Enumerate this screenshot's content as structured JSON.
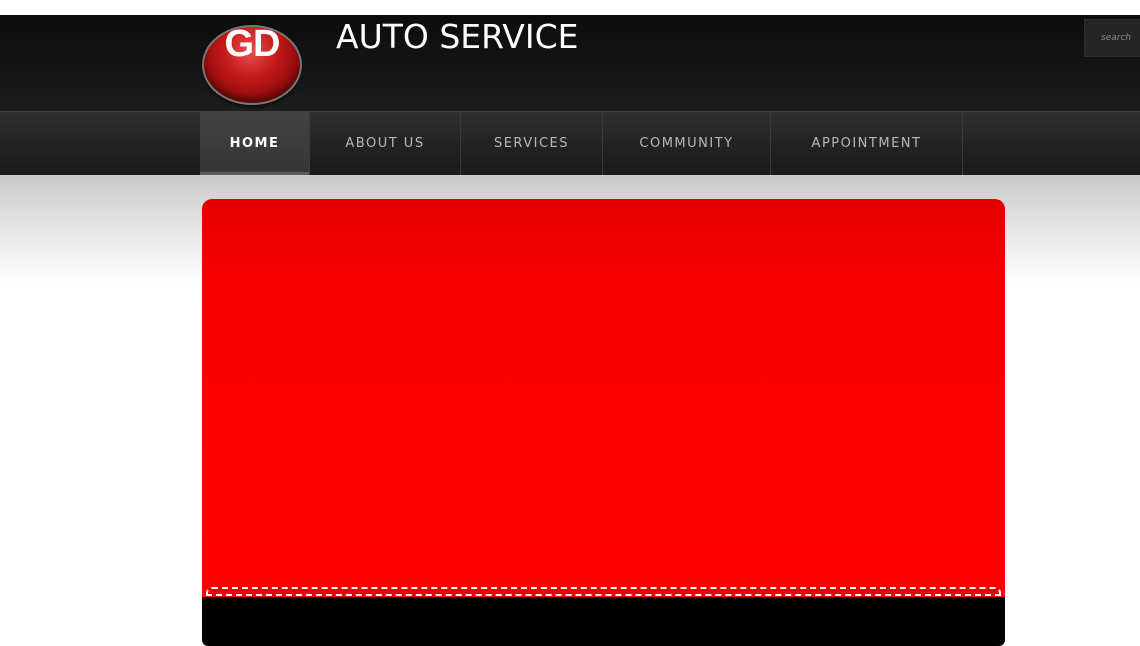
{
  "header": {
    "logo_text": "GD",
    "brand_title": "AUTO SERVICE",
    "search_placeholder": "search"
  },
  "nav": {
    "items": [
      {
        "label": "HOME",
        "active": true
      },
      {
        "label": "ABOUT US",
        "active": false
      },
      {
        "label": "SERVICES",
        "active": false
      },
      {
        "label": "COMMUNITY",
        "active": false
      },
      {
        "label": "APPOINTMENT",
        "active": false
      }
    ]
  },
  "colors": {
    "header_bg": "#111111",
    "nav_bg": "#262626",
    "logo_red": "#c41818",
    "hero_red": "#ff0000",
    "hero_footer": "#000000"
  }
}
